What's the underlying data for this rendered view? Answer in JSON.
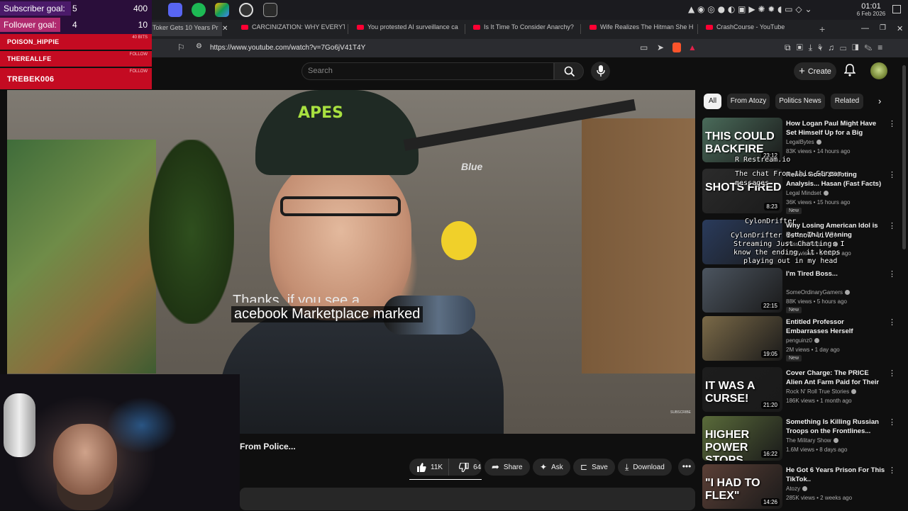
{
  "stream_overlay": {
    "goals": [
      {
        "label": "Subscriber goal:",
        "current": "5",
        "target": "400"
      },
      {
        "label": "Follower goal:",
        "current": "4",
        "target": "10"
      }
    ],
    "alerts": [
      {
        "name": "POISON_HIPPIE",
        "tag": "40 BITS"
      },
      {
        "name": "THEREALLFE",
        "tag": "FOLLOW"
      },
      {
        "name": "TREBEK006",
        "tag": "FOLLOW"
      }
    ],
    "chat": [
      "R Restream.io",
      "The chat From this Stream",
      "messages",
      "CylonDrifter",
      "CylonDrifter is now live!",
      "Streaming Just Chatting: I",
      "know the ending, it keeps",
      "playing out in my head"
    ]
  },
  "taskbar": {
    "time": "01:01",
    "date": "6 Feb 2026"
  },
  "browser": {
    "tabs": [
      {
        "title": "Toker Gets 10 Years Pr"
      },
      {
        "title": "CARCINIZATION: WHY EVERYTHI"
      },
      {
        "title": "You protested AI surveillance ca"
      },
      {
        "title": "Is It Time To Consider Anarchy?"
      },
      {
        "title": "Wife Realizes The Hitman She H"
      },
      {
        "title": "CrashCourse - YouTube"
      }
    ],
    "url": "https://www.youtube.com/watch?v=7Go6jV41T4Y"
  },
  "youtube": {
    "search_placeholder": "Search",
    "create_label": "Create",
    "video": {
      "subtitle_partial": "Thanks, if you see a",
      "subtitle": "acebook Marketplace marked",
      "watermark": "SUBSCRIBE",
      "cap_logo": "APES",
      "mic_brand": "Blue",
      "title": "From Police..."
    },
    "actions": {
      "likes": "11K",
      "dislikes": "64",
      "share": "Share",
      "ask": "Ask",
      "save": "Save",
      "download": "Download"
    },
    "chips": [
      "All",
      "From Atozy",
      "Politics News",
      "Related"
    ],
    "recommendations": [
      {
        "title": "How Logan Paul Might Have Set Himself Up for a Big Backfire | ...",
        "channel": "LegalBytes",
        "meta": "83K views • 14 hours ago",
        "duration": "23:12",
        "thumb_text": "THIS COULD BACKFIRE",
        "new": false,
        "thumb_color": "#4a6b5a"
      },
      {
        "title": "Renee Good Shooting Analysis... Hasan (Fast Facts)",
        "channel": "Legal Mindset",
        "meta": "36K views • 15 hours ago",
        "duration": "8:23",
        "thumb_text": "SHOTS FIRED",
        "new": true,
        "thumb_color": "#2b2b2b"
      },
      {
        "title": "Why Losing American Idol is Better Than Winning",
        "channel": "Pass the Popcorn",
        "meta": "1.2M views • 1 month ago",
        "duration": "",
        "thumb_text": "",
        "new": false,
        "thumb_color": "#2a3b5c"
      },
      {
        "title": "I'm Tired Boss...",
        "channel": "SomeOrdinaryGamers",
        "meta": "88K views • 5 hours ago",
        "duration": "22:15",
        "thumb_text": "",
        "new": true,
        "thumb_color": "#4c5560"
      },
      {
        "title": "Entitled Professor Embarrasses Herself",
        "channel": "penguinz0",
        "meta": "2M views • 1 day ago",
        "duration": "19:05",
        "thumb_text": "",
        "new": true,
        "thumb_color": "#7b6a48"
      },
      {
        "title": "Cover Charge: The PRICE Alien Ant Farm Paid for Their Bigges...",
        "channel": "Rock N' Roll True Stories",
        "meta": "186K views • 1 month ago",
        "duration": "21:20",
        "thumb_text": "IT WAS A CURSE!",
        "new": false,
        "thumb_color": "#1d1d1d"
      },
      {
        "title": "Something Is Killing Russian Troops on the Frontlines... and...",
        "channel": "The Military Show",
        "meta": "1.6M views • 8 days ago",
        "duration": "16:22",
        "thumb_text": "HIGHER POWER STOPS RUSSIA",
        "new": false,
        "thumb_color": "#5a6b3a"
      },
      {
        "title": "He Got 6 Years Prison For This TikTok..",
        "channel": "Atozy",
        "meta": "285K views • 2 weeks ago",
        "duration": "14:26",
        "thumb_text": "\"I HAD TO FLEX\"",
        "new": false,
        "thumb_color": "#5b3f36"
      }
    ]
  },
  "colors": {
    "youtube_red": "#ff0033",
    "alert_red": "#c40b22",
    "goal_purple": "#4b1a6a",
    "goal_pink": "#b02a6e"
  }
}
